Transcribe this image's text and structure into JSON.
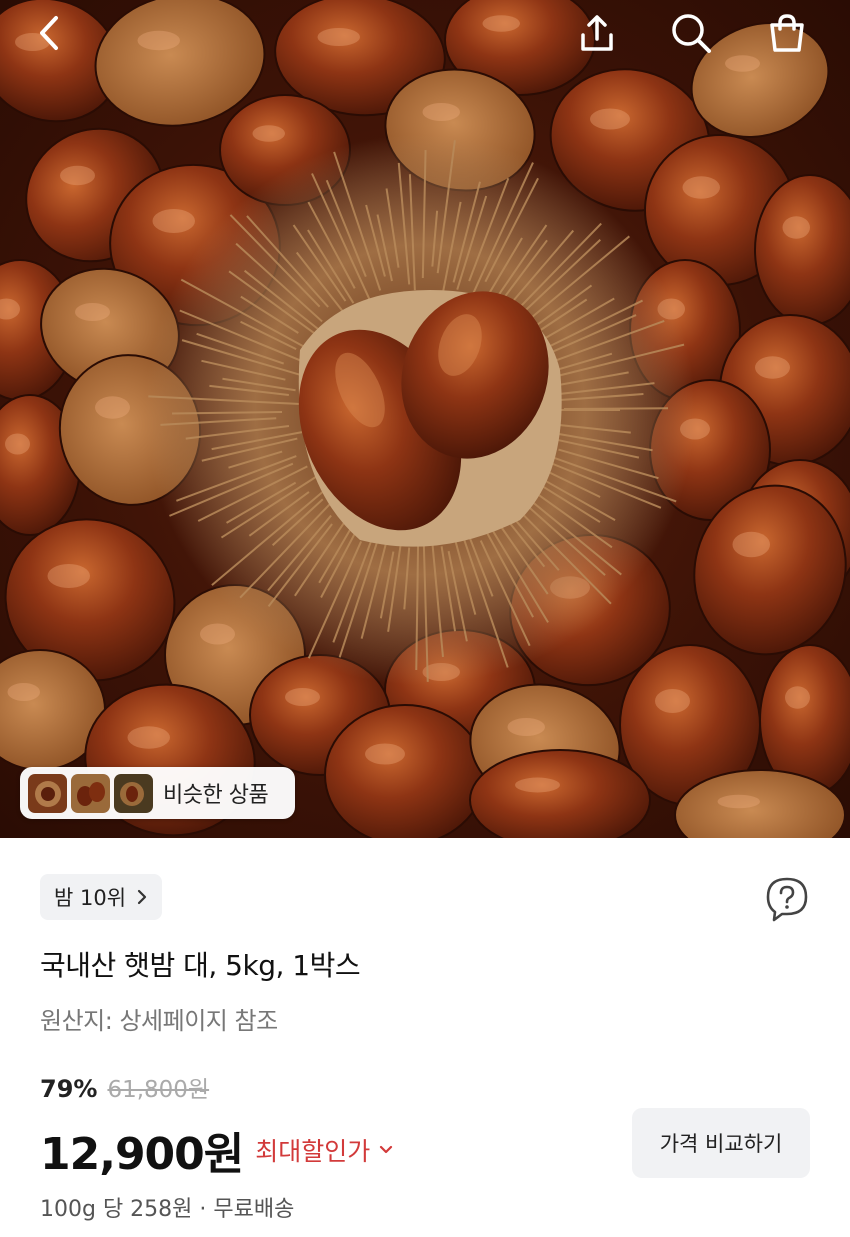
{
  "header": {
    "back_icon": "chevron-left-icon",
    "share_icon": "share-icon",
    "search_icon": "search-icon",
    "cart_icon": "shopping-bag-icon"
  },
  "hero": {
    "similar_products_label": "비슷한 상품"
  },
  "product": {
    "rank_label": "밤 10위",
    "title": "국내산 햇밤 대, 5kg, 1박스",
    "origin": "원산지: 상세페이지 참조",
    "discount_rate": "79%",
    "original_price": "61,800원",
    "price": "12,900원",
    "max_discount_label": "최대할인가",
    "compare_button": "가격 비교하기",
    "unit_info": "100g 당 258원 · 무료배송"
  },
  "colors": {
    "accent_red": "#d23a3a",
    "chip_bg": "#f1f2f4",
    "chestnut": "#7a2a10"
  }
}
